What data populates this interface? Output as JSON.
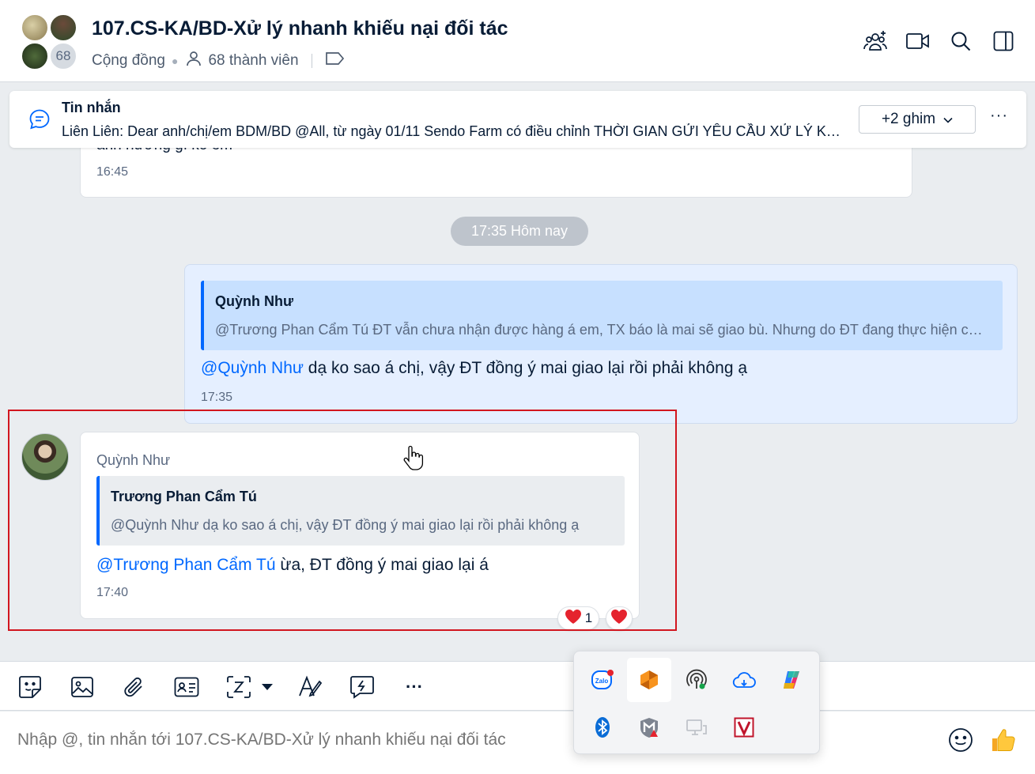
{
  "header": {
    "title": "107.CS-KA/BD-Xử lý nhanh khiếu nại đối tác",
    "avatar_count": "68",
    "group_type": "Cộng đồng",
    "member_count": "68 thành viên"
  },
  "pinned": {
    "title": "Tin nhắn",
    "text": "Liên Liên: Dear anh/chị/em BDM/BD @All, từ ngày 01/11 Sendo Farm có điều chỉnh THỜI GIAN GỬI YÊU CẦU XỬ LÝ KHIẾU NẠI",
    "more_button": "+2 ghim",
    "more_menu": "···"
  },
  "messages": {
    "previous": {
      "cut_text": "ảnh hưởng gì ko em",
      "time": "16:45"
    },
    "date_separator": "17:35 Hôm nay",
    "outgoing": {
      "quote_name": "Quỳnh Như",
      "quote_text": "@Trương Phan Cẩm Tú ĐT vẫn chưa nhận được hàng á em, TX báo là mai sẽ giao bù. Nhưng do ĐT đang thực hiện chương trình",
      "mention": "@Quỳnh Như",
      "text": " dạ ko sao á chị, vậy ĐT đồng ý mai giao lại rồi phải không ạ",
      "time": "17:35"
    },
    "incoming": {
      "sender": "Quỳnh Như",
      "quote_name": "Trương Phan Cẩm Tú",
      "quote_text": "@Quỳnh Như dạ ko sao á chị, vậy ĐT đồng ý mai giao lại rồi phải không ạ",
      "mention": "@Trương Phan Cẩm Tú",
      "text": " ừa, ĐT đồng ý mai giao lại á",
      "time": "17:40",
      "reaction_count": "1"
    }
  },
  "composer": {
    "placeholder": "Nhập @, tin nhắn tới 107.CS-KA/BD-Xử lý nhanh khiếu nại đối tác",
    "more_tools": "···"
  },
  "tray": {
    "items": [
      "zalo-icon",
      "app-orange-icon",
      "broadcast-icon",
      "cloud-icon",
      "copilot-icon",
      "bluetooth-icon",
      "mcafee-icon",
      "display-icon",
      "v-app-icon"
    ]
  },
  "colors": {
    "accent": "#0068ff",
    "highlight_border": "#d2161f",
    "outgoing_bg": "#e5efff",
    "quote_bg": "#c7e0ff",
    "heart": "#e5232e"
  }
}
